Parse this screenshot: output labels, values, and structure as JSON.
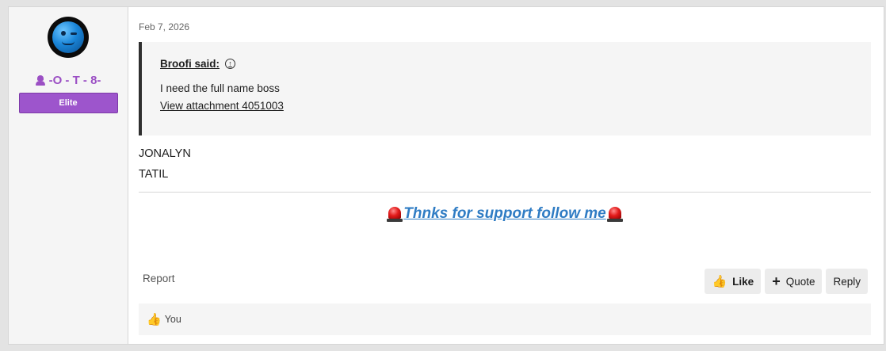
{
  "user": {
    "username": "-O - T - 8-",
    "banner": "Elite"
  },
  "post": {
    "date": "Feb 7, 2026",
    "quote": {
      "author": "Broofi said:",
      "text": "I need the full name boss",
      "attachment_link": "View attachment 4051003"
    },
    "message_lines": [
      "JONALYN",
      "TATIL"
    ],
    "signature": "Thnks for support follow me"
  },
  "actions": {
    "report": "Report",
    "like": "Like",
    "quote": "Quote",
    "reply": "Reply"
  },
  "reactions": {
    "text": "You"
  },
  "icons": {
    "like": "thumbs-up-icon",
    "quote": "plus-icon",
    "jump": "arrow-up-circle-icon",
    "signature": "siren-icon",
    "user_title": "user-icon"
  },
  "colors": {
    "username": "#9b4fc4",
    "banner": "#9d55cc",
    "signature_link": "#2f7cc4"
  }
}
